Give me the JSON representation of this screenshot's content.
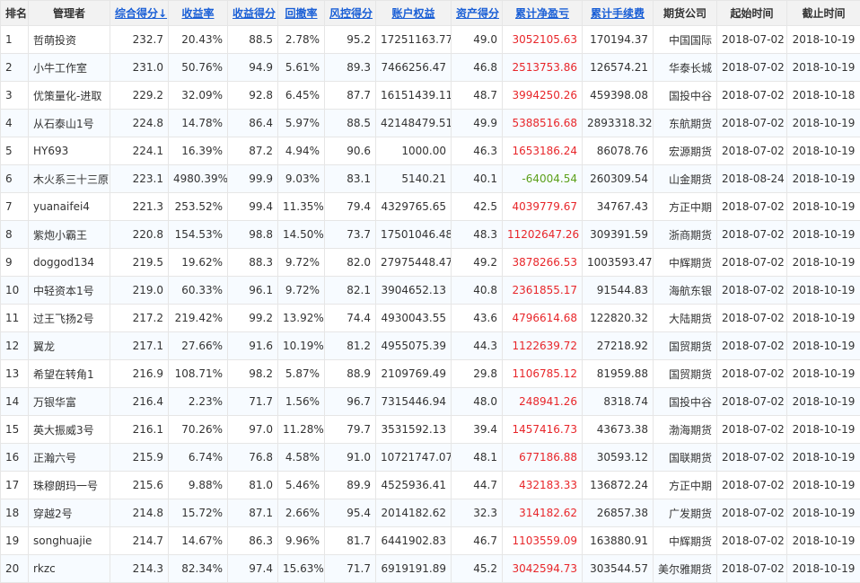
{
  "table": {
    "columns": [
      {
        "key": "rank",
        "label": "排名",
        "sortable": false
      },
      {
        "key": "manager",
        "label": "管理者",
        "sortable": false
      },
      {
        "key": "score",
        "label": "综合得分↓",
        "sortable": true
      },
      {
        "key": "return_rate",
        "label": "收益率",
        "sortable": true
      },
      {
        "key": "return_score",
        "label": "收益得分",
        "sortable": true
      },
      {
        "key": "drawdown",
        "label": "回撤率",
        "sortable": true
      },
      {
        "key": "risk_score",
        "label": "风控得分",
        "sortable": true
      },
      {
        "key": "equity",
        "label": "账户权益",
        "sortable": true
      },
      {
        "key": "asset_score",
        "label": "资产得分",
        "sortable": true
      },
      {
        "key": "net_profit",
        "label": "累计净盈亏",
        "sortable": true
      },
      {
        "key": "fees",
        "label": "累计手续费",
        "sortable": true
      },
      {
        "key": "firm",
        "label": "期货公司",
        "sortable": false
      },
      {
        "key": "start",
        "label": "起始时间",
        "sortable": false
      },
      {
        "key": "end",
        "label": "截止时间",
        "sortable": false
      }
    ],
    "rows": [
      {
        "rank": "1",
        "manager": "哲萌投资",
        "score": "232.7",
        "return_rate": "20.43%",
        "return_score": "88.5",
        "drawdown": "2.78%",
        "risk_score": "95.2",
        "equity": "17251163.77",
        "asset_score": "49.0",
        "net_profit": "3052105.63",
        "fees": "170194.37",
        "firm": "中国国际",
        "start": "2018-07-02",
        "end": "2018-10-19"
      },
      {
        "rank": "2",
        "manager": "小牛工作室",
        "score": "231.0",
        "return_rate": "50.76%",
        "return_score": "94.9",
        "drawdown": "5.61%",
        "risk_score": "89.3",
        "equity": "7466256.47",
        "asset_score": "46.8",
        "net_profit": "2513753.86",
        "fees": "126574.21",
        "firm": "华泰长城",
        "start": "2018-07-02",
        "end": "2018-10-19"
      },
      {
        "rank": "3",
        "manager": "优策量化-进取",
        "score": "229.2",
        "return_rate": "32.09%",
        "return_score": "92.8",
        "drawdown": "6.45%",
        "risk_score": "87.7",
        "equity": "16151439.11",
        "asset_score": "48.7",
        "net_profit": "3994250.26",
        "fees": "459398.08",
        "firm": "国投中谷",
        "start": "2018-07-02",
        "end": "2018-10-18"
      },
      {
        "rank": "4",
        "manager": "从石泰山1号",
        "score": "224.8",
        "return_rate": "14.78%",
        "return_score": "86.4",
        "drawdown": "5.97%",
        "risk_score": "88.5",
        "equity": "42148479.51",
        "asset_score": "49.9",
        "net_profit": "5388516.68",
        "fees": "2893318.32",
        "firm": "东航期货",
        "start": "2018-07-02",
        "end": "2018-10-19"
      },
      {
        "rank": "5",
        "manager": "HY693",
        "score": "224.1",
        "return_rate": "16.39%",
        "return_score": "87.2",
        "drawdown": "4.94%",
        "risk_score": "90.6",
        "equity": "1000.00",
        "asset_score": "46.3",
        "net_profit": "1653186.24",
        "fees": "86078.76",
        "firm": "宏源期货",
        "start": "2018-07-02",
        "end": "2018-10-19"
      },
      {
        "rank": "6",
        "manager": "木火系三十三原",
        "score": "223.1",
        "return_rate": "4980.39%",
        "return_score": "99.9",
        "drawdown": "9.03%",
        "risk_score": "83.1",
        "equity": "5140.21",
        "asset_score": "40.1",
        "net_profit": "-64004.54",
        "fees": "260309.54",
        "firm": "山金期货",
        "start": "2018-08-24",
        "end": "2018-10-19"
      },
      {
        "rank": "7",
        "manager": "yuanaifei4",
        "score": "221.3",
        "return_rate": "253.52%",
        "return_score": "99.4",
        "drawdown": "11.35%",
        "risk_score": "79.4",
        "equity": "4329765.65",
        "asset_score": "42.5",
        "net_profit": "4039779.67",
        "fees": "34767.43",
        "firm": "方正中期",
        "start": "2018-07-02",
        "end": "2018-10-19"
      },
      {
        "rank": "8",
        "manager": "紫炮小霸王",
        "score": "220.8",
        "return_rate": "154.53%",
        "return_score": "98.8",
        "drawdown": "14.50%",
        "risk_score": "73.7",
        "equity": "17501046.48",
        "asset_score": "48.3",
        "net_profit": "11202647.26",
        "fees": "309391.59",
        "firm": "浙商期货",
        "start": "2018-07-02",
        "end": "2018-10-19"
      },
      {
        "rank": "9",
        "manager": "doggod134",
        "score": "219.5",
        "return_rate": "19.62%",
        "return_score": "88.3",
        "drawdown": "9.72%",
        "risk_score": "82.0",
        "equity": "27975448.47",
        "asset_score": "49.2",
        "net_profit": "3878266.53",
        "fees": "1003593.47",
        "firm": "中辉期货",
        "start": "2018-07-02",
        "end": "2018-10-19"
      },
      {
        "rank": "10",
        "manager": "中轻资本1号",
        "score": "219.0",
        "return_rate": "60.33%",
        "return_score": "96.1",
        "drawdown": "9.72%",
        "risk_score": "82.1",
        "equity": "3904652.13",
        "asset_score": "40.8",
        "net_profit": "2361855.17",
        "fees": "91544.83",
        "firm": "海航东银",
        "start": "2018-07-02",
        "end": "2018-10-19"
      },
      {
        "rank": "11",
        "manager": "过王飞扬2号",
        "score": "217.2",
        "return_rate": "219.42%",
        "return_score": "99.2",
        "drawdown": "13.92%",
        "risk_score": "74.4",
        "equity": "4930043.55",
        "asset_score": "43.6",
        "net_profit": "4796614.68",
        "fees": "122820.32",
        "firm": "大陆期货",
        "start": "2018-07-02",
        "end": "2018-10-19"
      },
      {
        "rank": "12",
        "manager": "翼龙",
        "score": "217.1",
        "return_rate": "27.66%",
        "return_score": "91.6",
        "drawdown": "10.19%",
        "risk_score": "81.2",
        "equity": "4955075.39",
        "asset_score": "44.3",
        "net_profit": "1122639.72",
        "fees": "27218.92",
        "firm": "国贸期货",
        "start": "2018-07-02",
        "end": "2018-10-19"
      },
      {
        "rank": "13",
        "manager": "希望在转角1",
        "score": "216.9",
        "return_rate": "108.71%",
        "return_score": "98.2",
        "drawdown": "5.87%",
        "risk_score": "88.9",
        "equity": "2109769.49",
        "asset_score": "29.8",
        "net_profit": "1106785.12",
        "fees": "81959.88",
        "firm": "国贸期货",
        "start": "2018-07-02",
        "end": "2018-10-19"
      },
      {
        "rank": "14",
        "manager": "万银华富",
        "score": "216.4",
        "return_rate": "2.23%",
        "return_score": "71.7",
        "drawdown": "1.56%",
        "risk_score": "96.7",
        "equity": "7315446.94",
        "asset_score": "48.0",
        "net_profit": "248941.26",
        "fees": "8318.74",
        "firm": "国投中谷",
        "start": "2018-07-02",
        "end": "2018-10-19"
      },
      {
        "rank": "15",
        "manager": "英大振威3号",
        "score": "216.1",
        "return_rate": "70.26%",
        "return_score": "97.0",
        "drawdown": "11.28%",
        "risk_score": "79.7",
        "equity": "3531592.13",
        "asset_score": "39.4",
        "net_profit": "1457416.73",
        "fees": "43673.38",
        "firm": "渤海期货",
        "start": "2018-07-02",
        "end": "2018-10-19"
      },
      {
        "rank": "16",
        "manager": "正瀚六号",
        "score": "215.9",
        "return_rate": "6.74%",
        "return_score": "76.8",
        "drawdown": "4.58%",
        "risk_score": "91.0",
        "equity": "10721747.07",
        "asset_score": "48.1",
        "net_profit": "677186.88",
        "fees": "30593.12",
        "firm": "国联期货",
        "start": "2018-07-02",
        "end": "2018-10-19"
      },
      {
        "rank": "17",
        "manager": "珠穆朗玛一号",
        "score": "215.6",
        "return_rate": "9.88%",
        "return_score": "81.0",
        "drawdown": "5.46%",
        "risk_score": "89.9",
        "equity": "4525936.41",
        "asset_score": "44.7",
        "net_profit": "432183.33",
        "fees": "136872.24",
        "firm": "方正中期",
        "start": "2018-07-02",
        "end": "2018-10-19"
      },
      {
        "rank": "18",
        "manager": "穿越2号",
        "score": "214.8",
        "return_rate": "15.72%",
        "return_score": "87.1",
        "drawdown": "2.66%",
        "risk_score": "95.4",
        "equity": "2014182.62",
        "asset_score": "32.3",
        "net_profit": "314182.62",
        "fees": "26857.38",
        "firm": "广发期货",
        "start": "2018-07-02",
        "end": "2018-10-19"
      },
      {
        "rank": "19",
        "manager": "songhuajie",
        "score": "214.7",
        "return_rate": "14.67%",
        "return_score": "86.3",
        "drawdown": "9.96%",
        "risk_score": "81.7",
        "equity": "6441902.83",
        "asset_score": "46.7",
        "net_profit": "1103559.09",
        "fees": "163880.91",
        "firm": "中辉期货",
        "start": "2018-07-02",
        "end": "2018-10-19"
      },
      {
        "rank": "20",
        "manager": "rkzc",
        "score": "214.3",
        "return_rate": "82.34%",
        "return_score": "97.4",
        "drawdown": "15.63%",
        "risk_score": "71.7",
        "equity": "6919191.89",
        "asset_score": "45.2",
        "net_profit": "3042594.73",
        "fees": "303544.57",
        "firm": "美尔雅期货",
        "start": "2018-07-02",
        "end": "2018-10-19"
      }
    ]
  },
  "colors": {
    "header_bg": "#f2f2f2",
    "link_blue": "#1a5fd6",
    "profit_red": "#e8262a",
    "loss_green": "#5ca01a",
    "row_alt_bg": "#f7fbff",
    "border": "#e6e6e6"
  }
}
